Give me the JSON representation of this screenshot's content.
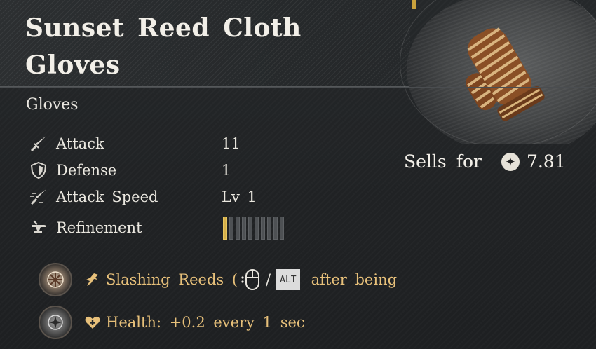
{
  "item": {
    "title_line1": "Sunset Reed Cloth",
    "title_line2": "Gloves",
    "category": "Gloves",
    "image_icon": "reed-cloth-glove-icon"
  },
  "sell": {
    "label": "Sells for",
    "currency_icon": "silver-coin-icon",
    "value": "7.81"
  },
  "stats": [
    {
      "label": "Attack",
      "value": "11",
      "icon": "sword-icon"
    },
    {
      "label": "Defense",
      "value": "1",
      "icon": "shield-icon"
    },
    {
      "label": "Attack Speed",
      "value": "Lv 1",
      "icon": "swift-sword-icon"
    },
    {
      "label": "Refinement",
      "icon": "anvil-icon",
      "level": 1,
      "max": 10
    }
  ],
  "effects": [
    {
      "badge_icon": "bronze-emblem-icon",
      "type_icon": "running-icon",
      "text_before": "Slashing Reeds (",
      "key_alt": "ALT",
      "text_after": "after being"
    },
    {
      "badge_icon": "silver-emblem-icon",
      "type_icon": "heart-plus-icon",
      "text": "Health: +0.2 every 1 sec"
    }
  ],
  "colors": {
    "accent_gold": "#d6b04a",
    "effect_text": "#e7c07a",
    "background": "#202224"
  }
}
